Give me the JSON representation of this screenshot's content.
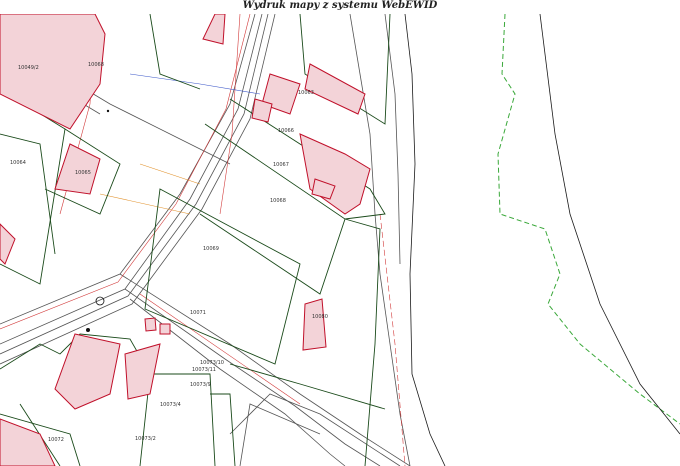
{
  "header": {
    "title": "Wydruk mapy z systemu WebEWID"
  },
  "parcels": [
    {
      "id": "p10068",
      "label": "10068"
    },
    {
      "id": "p10064",
      "label": "10064"
    },
    {
      "id": "p10065",
      "label": "10065"
    },
    {
      "id": "p10063",
      "label": "10063"
    },
    {
      "id": "p10066",
      "label": "10066"
    },
    {
      "id": "p10067",
      "label": "10067"
    },
    {
      "id": "p10068b",
      "label": "10068"
    },
    {
      "id": "p10069",
      "label": "10069"
    },
    {
      "id": "p10080",
      "label": "10080"
    },
    {
      "id": "p10073",
      "label": "10073/10"
    },
    {
      "id": "p10073b",
      "label": "10073/11"
    },
    {
      "id": "p10073c",
      "label": "10073/9"
    },
    {
      "id": "p10073d",
      "label": "10073/4"
    },
    {
      "id": "p10073e",
      "label": "10073/2"
    },
    {
      "id": "p10072",
      "label": "10072"
    },
    {
      "id": "p10049",
      "label": "10049/2"
    },
    {
      "id": "p10071",
      "label": "10071"
    }
  ],
  "colors": {
    "building_fill": "#f3d3d8",
    "building_stroke": "#c0102a",
    "parcel_line": "#1a6b1a",
    "boundary_dash": "#3aa83a",
    "road_line": "#555555"
  }
}
